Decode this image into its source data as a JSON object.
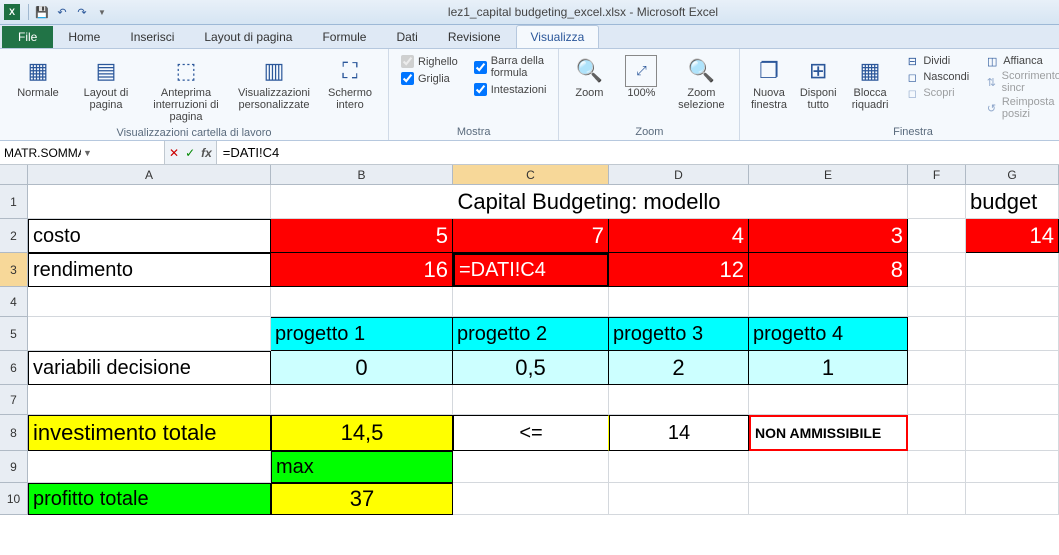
{
  "app": {
    "title": "lez1_capital budgeting_excel.xlsx - Microsoft Excel"
  },
  "tabs": {
    "file": "File",
    "home": "Home",
    "inserisci": "Inserisci",
    "layout": "Layout di pagina",
    "formule": "Formule",
    "dati": "Dati",
    "revisione": "Revisione",
    "visualizza": "Visualizza"
  },
  "ribbon": {
    "views": {
      "normale": "Normale",
      "layout": "Layout di pagina",
      "anteprima": "Anteprima interruzioni di pagina",
      "personalizzate": "Visualizzazioni personalizzate",
      "schermo": "Schermo intero",
      "group_label": "Visualizzazioni cartella di lavoro"
    },
    "mostra": {
      "righello": "Righello",
      "griglia": "Griglia",
      "barra": "Barra della formula",
      "intestazioni": "Intestazioni",
      "group_label": "Mostra"
    },
    "zoom": {
      "zoom": "Zoom",
      "cento": "100%",
      "selezione": "Zoom selezione",
      "group_label": "Zoom"
    },
    "finestra": {
      "nuova": "Nuova finestra",
      "disponi": "Disponi tutto",
      "blocca": "Blocca riquadri",
      "dividi": "Dividi",
      "nascondi": "Nascondi",
      "scopri": "Scopri",
      "affianca": "Affianca",
      "scorri": "Scorrimento sincr",
      "reimposta": "Reimposta posizi",
      "group_label": "Finestra"
    }
  },
  "formula_bar": {
    "name_box": "MATR.SOMMA.PRO...",
    "formula": "=DATI!C4"
  },
  "columns": [
    "A",
    "B",
    "C",
    "D",
    "E",
    "F",
    "G"
  ],
  "rows": [
    "1",
    "2",
    "3",
    "4",
    "5",
    "6",
    "7",
    "8",
    "9",
    "10"
  ],
  "sheet": {
    "title_merged": "Capital Budgeting: modello",
    "budget_label": "budget",
    "budget_value": "14",
    "r2": {
      "label": "costo",
      "B": "5",
      "C": "7",
      "D": "4",
      "E": "3"
    },
    "r3": {
      "label": "rendimento",
      "B": "16",
      "C_editing": "=DATI!C4",
      "D": "12",
      "E": "8"
    },
    "r5": {
      "B": "progetto 1",
      "C": "progetto 2",
      "D": "progetto 3",
      "E": "progetto 4"
    },
    "r6": {
      "label": "variabili decisione",
      "B": "0",
      "C": "0,5",
      "D": "2",
      "E": "1"
    },
    "r8": {
      "label": "investimento totale",
      "B": "14,5",
      "C": "<=",
      "D": "14",
      "E": "NON AMMISSIBILE"
    },
    "r9": {
      "B": "max"
    },
    "r10": {
      "label": "profitto totale",
      "B": "37"
    }
  }
}
